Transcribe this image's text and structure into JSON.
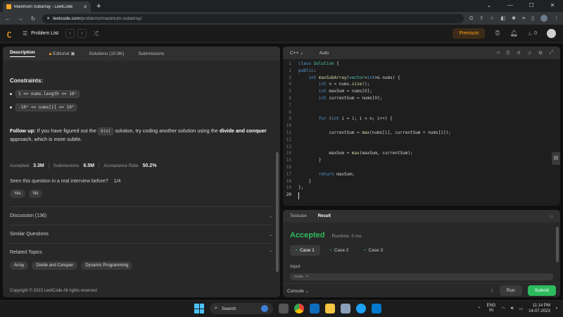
{
  "browser": {
    "tab_title": "Maximum Subarray - LeetCode",
    "url_host": "leetcode.com",
    "url_path": "/problems/maximum-subarray/"
  },
  "header": {
    "problem_list": "Problem List",
    "premium": "Premium",
    "streak": "0"
  },
  "left": {
    "tabs": [
      "Description",
      "Editorial",
      "Solutions (10.9K)",
      "Submissions"
    ],
    "constraints_title": "Constraints:",
    "constraint1": "1 <= nums.length <= 10⁵",
    "constraint2": "-10⁴ <= nums[i] <= 10⁴",
    "followup_lead": "Follow up:",
    "followup_text1": " If you have figured out the ",
    "followup_code": "O(n)",
    "followup_text2": " solution, try coding another solution using the ",
    "followup_bold": "divide and conquer",
    "followup_text3": " approach, which is more subtle.",
    "accepted_label": "Accepted",
    "accepted_value": "3.3M",
    "submissions_label": "Submissions",
    "submissions_value": "6.5M",
    "rate_label": "Acceptance Rate",
    "rate_value": "50.2%",
    "interview_q": "Seen this question in a real interview before?",
    "interview_count": "1/4",
    "yes": "Yes",
    "no": "No",
    "discussion": "Discussion (136)",
    "similar": "Similar Questions",
    "related": "Related Topics",
    "topics": [
      "Array",
      "Divide and Conquer",
      "Dynamic Programming"
    ],
    "copyright": "Copyright © 2023 LeetCode All rights reserved"
  },
  "editor": {
    "language": "C++",
    "mode": "Auto"
  },
  "result": {
    "tab_testcase": "Testcase",
    "tab_result": "Result",
    "status": "Accepted",
    "runtime": "Runtime: 5 ms",
    "cases": [
      "Case 1",
      "Case 2",
      "Case 3"
    ],
    "input_label": "Input",
    "input_preview": "nums =",
    "console": "Console",
    "run": "Run",
    "submit": "Submit"
  },
  "taskbar": {
    "search": "Search",
    "lang1": "ENG",
    "lang2": "IN",
    "time": "11:14 PM",
    "date": "14-07-2023"
  }
}
